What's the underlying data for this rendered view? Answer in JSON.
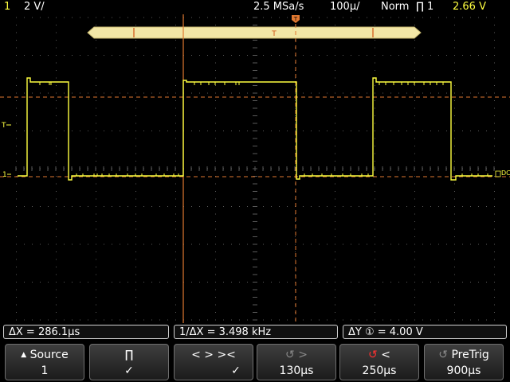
{
  "topbar": {
    "channel": "1",
    "scale": "2 V/",
    "sample_rate": "2.5 MSa/s",
    "timebase": "100µ/",
    "mode": "Norm",
    "trigger_channel": "1",
    "trigger_level": "2.66  V"
  },
  "markers": {
    "trigger_T": "T",
    "level_T": "T",
    "channel_1": "1",
    "dc": "DC"
  },
  "readouts": {
    "delta_x": "ΔX = 286.1µs",
    "inv_delta_x": "1/ΔX =  3.498 kHz",
    "delta_y": "ΔY ① =  4.00  V"
  },
  "softkeys": {
    "source_label": "Source",
    "source_value": "1",
    "pulse_symbol": "∏",
    "check": "✓",
    "arrows": "<  >  ><",
    "right_arrow": ">",
    "right_value": "130µs",
    "left_arrow": "<",
    "left_value": "250µs",
    "pretrig_label": "PreTrig",
    "pretrig_value": "900µs"
  },
  "colors": {
    "trace": "#ffff40",
    "cursor": "#e07830",
    "grid": "#505050",
    "background": "#000000"
  }
}
